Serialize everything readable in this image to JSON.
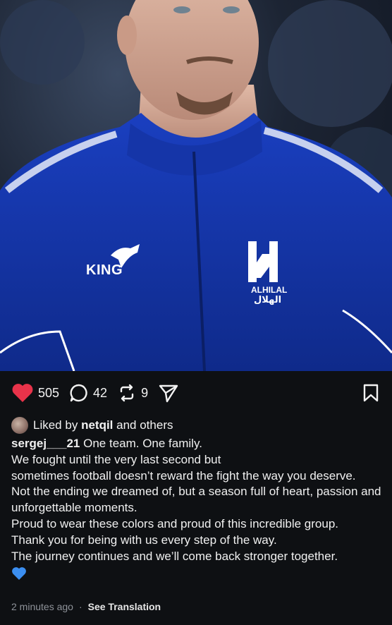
{
  "photo": {
    "jacket_brand_text": "KING",
    "club_name_text": "ALHILAL",
    "club_name_arabic": "الهلال"
  },
  "actions": {
    "likes": "505",
    "comments": "42",
    "reposts": "9",
    "colors": {
      "heart": "#e8334a",
      "icons": "#f2f2f2"
    }
  },
  "liked_by": {
    "prefix": "Liked by",
    "user": "netqil",
    "suffix": "and others"
  },
  "caption": {
    "username": "sergej___21",
    "lines": [
      "One team. One family.",
      "We fought until the very last second but",
      "sometimes football doesn’t reward the fight the way you deserve.",
      "Not the ending we dreamed of, but a season full of heart, passion and unforgettable moments.",
      "Proud to wear these colors and proud of this incredible group.",
      "Thank you for being with us every step of the way.",
      "The journey continues and we’ll come back stronger together."
    ],
    "emoji": "💙"
  },
  "footer": {
    "timestamp": "2 minutes ago",
    "separator": "·",
    "translate_label": "See Translation"
  }
}
